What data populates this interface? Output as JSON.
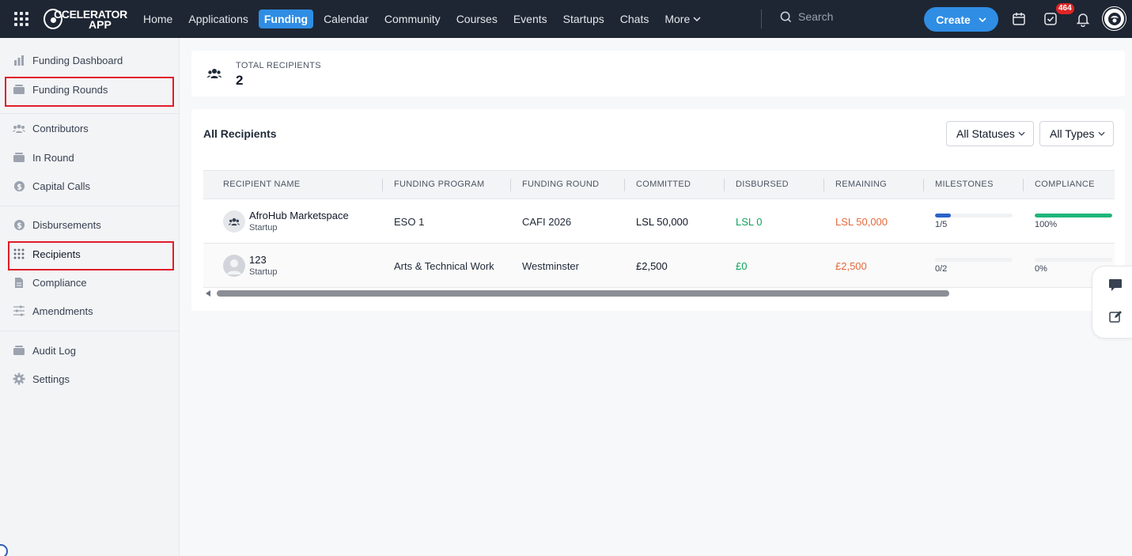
{
  "app": {
    "logo_line1": "CCELERATOR",
    "logo_line2": "APP"
  },
  "nav": {
    "items": [
      "Home",
      "Applications",
      "Funding",
      "Calendar",
      "Community",
      "Courses",
      "Events",
      "Startups",
      "Chats"
    ],
    "active": "Funding",
    "more_label": "More"
  },
  "search": {
    "placeholder": "Search"
  },
  "create": {
    "label": "Create"
  },
  "notifications": {
    "tasks_count": "464"
  },
  "sidebar": {
    "items": [
      {
        "label": "Funding Dashboard",
        "icon": "bar-chart-icon"
      },
      {
        "label": "Funding Rounds",
        "icon": "stack-icon"
      },
      {
        "label": "Contributors",
        "icon": "users-icon"
      },
      {
        "label": "In Round",
        "icon": "stack-icon"
      },
      {
        "label": "Capital Calls",
        "icon": "dollar-icon"
      },
      {
        "label": "Disbursements",
        "icon": "dollar-icon"
      },
      {
        "label": "Recipients",
        "icon": "grid-dots-icon"
      },
      {
        "label": "Compliance",
        "icon": "document-icon"
      },
      {
        "label": "Amendments",
        "icon": "sliders-icon"
      },
      {
        "label": "Audit Log",
        "icon": "stack-icon"
      },
      {
        "label": "Settings",
        "icon": "gear-icon"
      }
    ]
  },
  "summary": {
    "label": "TOTAL RECIPIENTS",
    "value": "2"
  },
  "recipients": {
    "title": "All Recipients",
    "filters": {
      "status": "All Statuses",
      "type": "All Types"
    },
    "columns": [
      "RECIPIENT NAME",
      "FUNDING PROGRAM",
      "FUNDING ROUND",
      "COMMITTED",
      "DISBURSED",
      "REMAINING",
      "MILESTONES",
      "COMPLIANCE"
    ],
    "rows": [
      {
        "name": "AfroHub Marketspace",
        "type": "Startup",
        "program": "ESO 1",
        "round": "CAFI 2026",
        "committed": "LSL 50,000",
        "disbursed": "LSL 0",
        "remaining": "LSL 50,000",
        "milestones_label": "1/5",
        "milestones_fraction": 0.2,
        "compliance_label": "100%",
        "compliance_fraction": 1.0
      },
      {
        "name": "123",
        "type": "Startup",
        "program": "Arts & Technical Work",
        "round": "Westminster",
        "committed": "£2,500",
        "disbursed": "£0",
        "remaining": "£2,500",
        "milestones_label": "0/2",
        "milestones_fraction": 0,
        "compliance_label": "0%",
        "compliance_fraction": 0
      }
    ]
  },
  "colors": {
    "accent": "#2f8de4",
    "positive": "#10a35c",
    "negative": "#e4683c",
    "milestone_bar": "#2a62c8",
    "compliance_bar": "#1fb57a",
    "highlight": "#e11d2a"
  }
}
